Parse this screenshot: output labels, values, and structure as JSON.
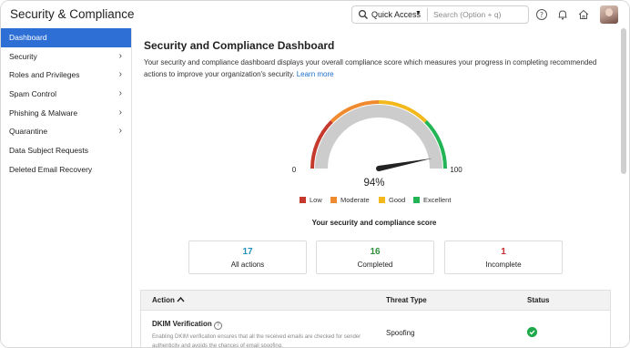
{
  "header": {
    "app_title": "Security & Compliance",
    "quick_access_label": "Quick Access",
    "search_placeholder": "Search (Option + q)"
  },
  "sidebar": {
    "items": [
      {
        "label": "Dashboard",
        "active": true,
        "has_chevron": false
      },
      {
        "label": "Security",
        "active": false,
        "has_chevron": true
      },
      {
        "label": "Roles and Privileges",
        "active": false,
        "has_chevron": true
      },
      {
        "label": "Spam Control",
        "active": false,
        "has_chevron": true
      },
      {
        "label": "Phishing & Malware",
        "active": false,
        "has_chevron": true
      },
      {
        "label": "Quarantine",
        "active": false,
        "has_chevron": true
      },
      {
        "label": "Data Subject Requests",
        "active": false,
        "has_chevron": false
      },
      {
        "label": "Deleted Email Recovery",
        "active": false,
        "has_chevron": false
      }
    ]
  },
  "main": {
    "title": "Security and Compliance Dashboard",
    "description": "Your security and compliance dashboard displays your overall compliance score which measures your progress in completing recommended actions to improve your organization's security.",
    "learn_more": "Learn more",
    "gauge": {
      "min_label": "0",
      "max_label": "100",
      "value": 94,
      "value_label": "94%"
    },
    "legend": [
      {
        "label": "Low",
        "color": "#c63a2e"
      },
      {
        "label": "Moderate",
        "color": "#ef8a2f"
      },
      {
        "label": "Good",
        "color": "#f2b81c"
      },
      {
        "label": "Excellent",
        "color": "#22b455"
      }
    ],
    "score_title": "Your security and compliance score",
    "stats": [
      {
        "value": "17",
        "label": "All actions",
        "color": "#2290b8"
      },
      {
        "value": "16",
        "label": "Completed",
        "color": "#2f8f3a"
      },
      {
        "value": "1",
        "label": "Incomplete",
        "color": "#c9302c"
      }
    ],
    "table": {
      "headers": {
        "action": "Action",
        "threat": "Threat Type",
        "status": "Status"
      },
      "rows": [
        {
          "title": "DKIM Verification",
          "description": "Enabling DKIM verification ensures that all the received emails are checked for sender authenticity and avoids the chances of email spoofing.",
          "threat": "Spoofing",
          "status": "complete"
        }
      ]
    }
  },
  "colors": {
    "accent": "#2e6fd6",
    "gauge_track": "#cccccc"
  }
}
